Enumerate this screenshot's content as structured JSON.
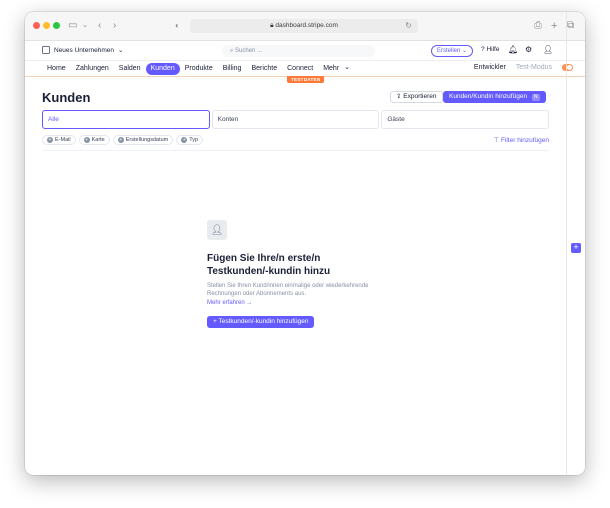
{
  "browser": {
    "url": "dashboard.stripe.com",
    "back_icon": "chevron-left-icon",
    "forward_icon": "chevron-right-icon"
  },
  "topbar": {
    "company": "Neues Unternehmen",
    "search_placeholder": "Suchen ...",
    "create_label": "Erstellen",
    "help_label": "Hilfe"
  },
  "nav": {
    "items": [
      {
        "label": "Home",
        "active": false
      },
      {
        "label": "Zahlungen",
        "active": false
      },
      {
        "label": "Salden",
        "active": false
      },
      {
        "label": "Kunden",
        "active": true
      },
      {
        "label": "Produkte",
        "active": false
      },
      {
        "label": "Billing",
        "active": false
      },
      {
        "label": "Berichte",
        "active": false
      },
      {
        "label": "Connect",
        "active": false
      },
      {
        "label": "Mehr",
        "active": false
      }
    ],
    "developer": "Entwickler",
    "test_mode": "Test-Modus",
    "test_badge": "TESTDATEN"
  },
  "page": {
    "title": "Kunden",
    "export_label": "Exportieren",
    "add_label": "Kunden/Kundin hinzufügen",
    "add_shortcut": "N",
    "segments": [
      "Alle",
      "Konten",
      "Gäste"
    ],
    "filters": [
      "E-Mail",
      "Karte",
      "Erstellungsdatum",
      "Typ"
    ],
    "add_filter": "Filter hinzufügen"
  },
  "empty_state": {
    "headline": "Fügen Sie Ihre/n erste/n Testkunden/-kundin hinzu",
    "description": "Stellen Sie Ihren Kund/innen einmalige oder wiederkehrende Rechnungen oder Abonnements aus.",
    "learn_more": "Mehr erfahren →",
    "button_label": "+ Testkunden/-kundin hinzufügen"
  },
  "colors": {
    "accent": "#635bff",
    "test_orange": "#ff7a38"
  }
}
